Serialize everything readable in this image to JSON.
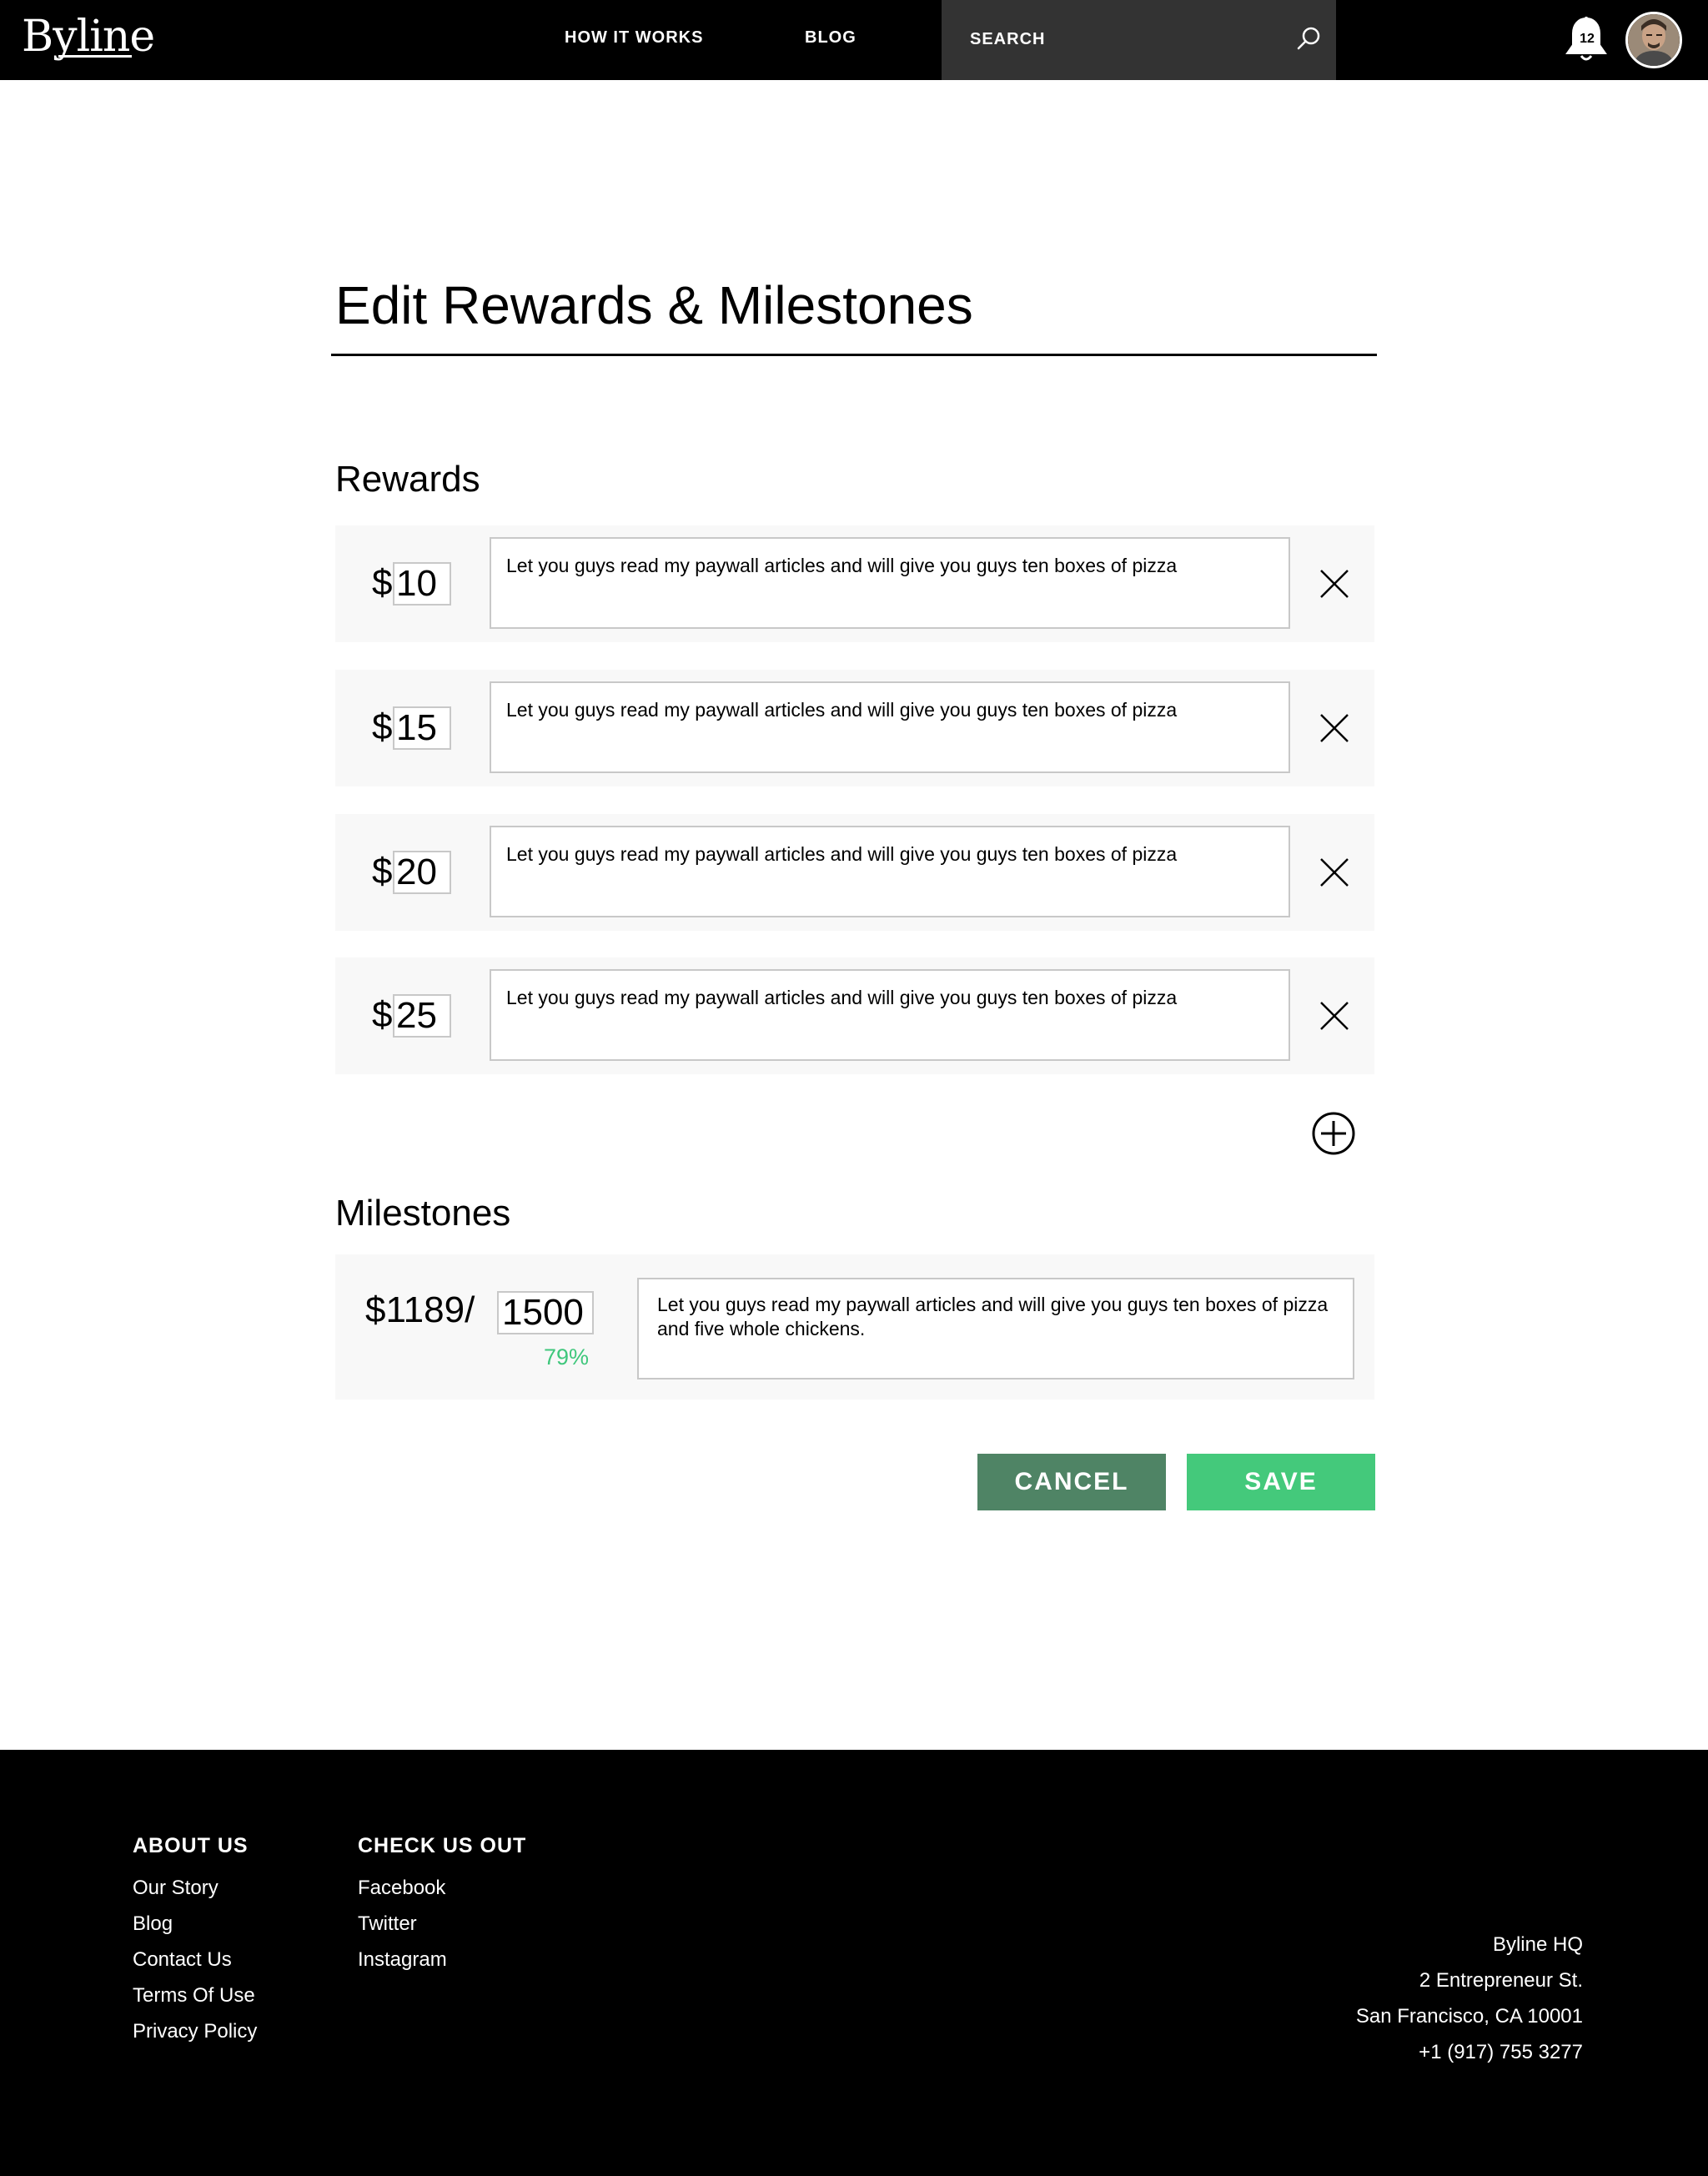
{
  "header": {
    "logo": "Byline",
    "nav": {
      "how_it_works": "HOW IT WORKS",
      "blog": "BLOG"
    },
    "search": {
      "placeholder": "SEARCH"
    },
    "notifications": {
      "count": "12"
    }
  },
  "main": {
    "title": "Edit Rewards & Milestones",
    "rewards_heading": "Rewards",
    "currency": "$",
    "rewards": [
      {
        "amount": "10",
        "description": "Let you guys read my paywall articles and will give you guys ten boxes of pizza"
      },
      {
        "amount": "15",
        "description": "Let you guys read my paywall articles and will give you guys ten boxes of pizza"
      },
      {
        "amount": "20",
        "description": "Let you guys read my paywall articles and will give you guys ten boxes of pizza"
      },
      {
        "amount": "25",
        "description": "Let you guys read my paywall articles and will give you guys ten boxes of pizza"
      }
    ],
    "milestones_heading": "Milestones",
    "milestone": {
      "current": "$1189/",
      "goal": "1500",
      "percent": "79%",
      "progress_fraction": 0.79,
      "description": "Let you guys read my paywall articles and will give you guys ten boxes of pizza and five whole chickens."
    },
    "buttons": {
      "cancel": "CANCEL",
      "save": "SAVE"
    }
  },
  "footer": {
    "about": {
      "heading": "ABOUT US",
      "links": [
        "Our Story",
        "Blog",
        "Contact Us",
        "Terms Of Use",
        "Privacy Policy"
      ]
    },
    "social": {
      "heading": "CHECK US OUT",
      "links": [
        "Facebook",
        "Twitter",
        "Instagram"
      ]
    },
    "address": [
      "Byline HQ",
      "2 Entrepreneur St.",
      "San Francisco, CA 10001",
      "+1 (917) 755 3277"
    ]
  },
  "colors": {
    "header_bg": "#000000",
    "search_bg": "#333333",
    "cancel": "#4f8465",
    "save": "#44c97b",
    "percent": "#3fc77c",
    "row_bg": "#f8f8f8"
  },
  "icons": [
    "search-icon",
    "bell-icon",
    "avatar",
    "close-icon",
    "plus-circle-icon"
  ]
}
